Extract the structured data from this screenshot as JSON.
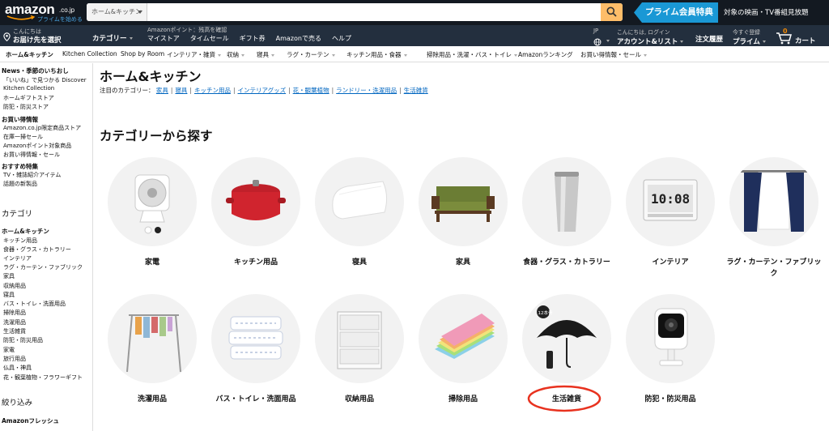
{
  "header": {
    "logo_text": "amazon",
    "logo_suffix": ".co.jp",
    "logo_prime": "プライムを始める",
    "search_category": "ホーム&キッチン",
    "search_placeholder": "",
    "prime_banner": "プライム会員特典",
    "prime_text": "対象の映画・TV番組見放題"
  },
  "nav": {
    "deliver_line1": "こんにちは",
    "deliver_line2": "お届け先を選択",
    "category": "カテゴリー",
    "points": "Amazonポイント：残高を確認",
    "links": [
      "マイストア",
      "タイムセール",
      "ギフト券",
      "Amazonで売る",
      "ヘルプ"
    ],
    "lang_small": "JP",
    "lang_icon": "globe-icon",
    "account_small": "こんにちは, ログイン",
    "account_big": "アカウント&リスト",
    "orders": "注文履歴",
    "prime_small": "今すぐ登録",
    "prime_big": "プライム",
    "cart_count": "0",
    "cart_label": "カート"
  },
  "subnav": {
    "items": [
      "ホーム&キッチン",
      "Kitchen Collection",
      "Shop by Room",
      "インテリア・雑貨",
      "収納",
      "寝具",
      "ラグ・カーテン",
      "キッチン用品・食器",
      "掃除用品・洗濯・バス・トイレ",
      "Amazonランキング",
      "お買い得情報・セール"
    ]
  },
  "sidebar": {
    "items": [
      "News・季節のいちおし",
      "「いいね」で見つかる Discover",
      "Kitchen Collection",
      "ホームギフトストア",
      "防犯・防災ストア",
      "お買い得情報",
      "Amazon.co.jp限定商品ストア",
      "在庫一掃セール",
      "Amazonポイント対象商品",
      "お買い得情報・セール",
      "おすすめ特集",
      "TV・雑誌紹介アイテム",
      "話題の新製品",
      "カテゴリ",
      "ホーム&キッチン",
      "キッチン用品",
      "食器・グラス・カトラリー",
      "インテリア",
      "ラグ・カーテン・ファブリック",
      "家具",
      "収納用品",
      "寝具",
      "バス・トイレ・洗面用品",
      "掃除用品",
      "洗濯用品",
      "生活雑貨",
      "防犯・防災用品",
      "家電",
      "旅行用品",
      "仏具・神具",
      "花・観葉植物・フラワーギフト",
      "絞り込み",
      "Amazonフレッシュ"
    ]
  },
  "main": {
    "title": "ホーム&キッチン",
    "featured_label": "注目のカテゴリー：",
    "featured_links": [
      "家具",
      "寝具",
      "キッチン用品",
      "インテリアグッズ",
      "花・観葉植物",
      "ランドリー・洗濯用品",
      "生活雑貨"
    ],
    "section_title": "カテゴリーから探す",
    "categories": [
      {
        "label": "家電",
        "icon": "fan-icon"
      },
      {
        "label": "キッチン用品",
        "icon": "pot-icon"
      },
      {
        "label": "寝具",
        "icon": "pillow-icon"
      },
      {
        "label": "家具",
        "icon": "sofa-icon"
      },
      {
        "label": "食器・グラス・カトラリー",
        "icon": "tumbler-icon"
      },
      {
        "label": "インテリア",
        "icon": "clock-icon"
      },
      {
        "label": "ラグ・カーテン・ファブリック",
        "icon": "curtain-icon"
      },
      {
        "label": "洗濯用品",
        "icon": "drying-rack-icon"
      },
      {
        "label": "バス・トイレ・洗面用品",
        "icon": "towels-icon"
      },
      {
        "label": "収納用品",
        "icon": "storage-drawer-icon"
      },
      {
        "label": "掃除用品",
        "icon": "cloths-icon"
      },
      {
        "label": "生活雑貨",
        "icon": "umbrella-icon"
      },
      {
        "label": "防犯・防災用品",
        "icon": "camera-icon"
      }
    ],
    "clock_text": "10:08",
    "umbrella_badge": "12本骨"
  },
  "colors": {
    "nav_dark": "#131921",
    "nav_main": "#232f3e",
    "search_button": "#febd69",
    "prime_blue": "#1a98d5",
    "link": "#0066c0",
    "highlight_circle": "#e8321f"
  }
}
